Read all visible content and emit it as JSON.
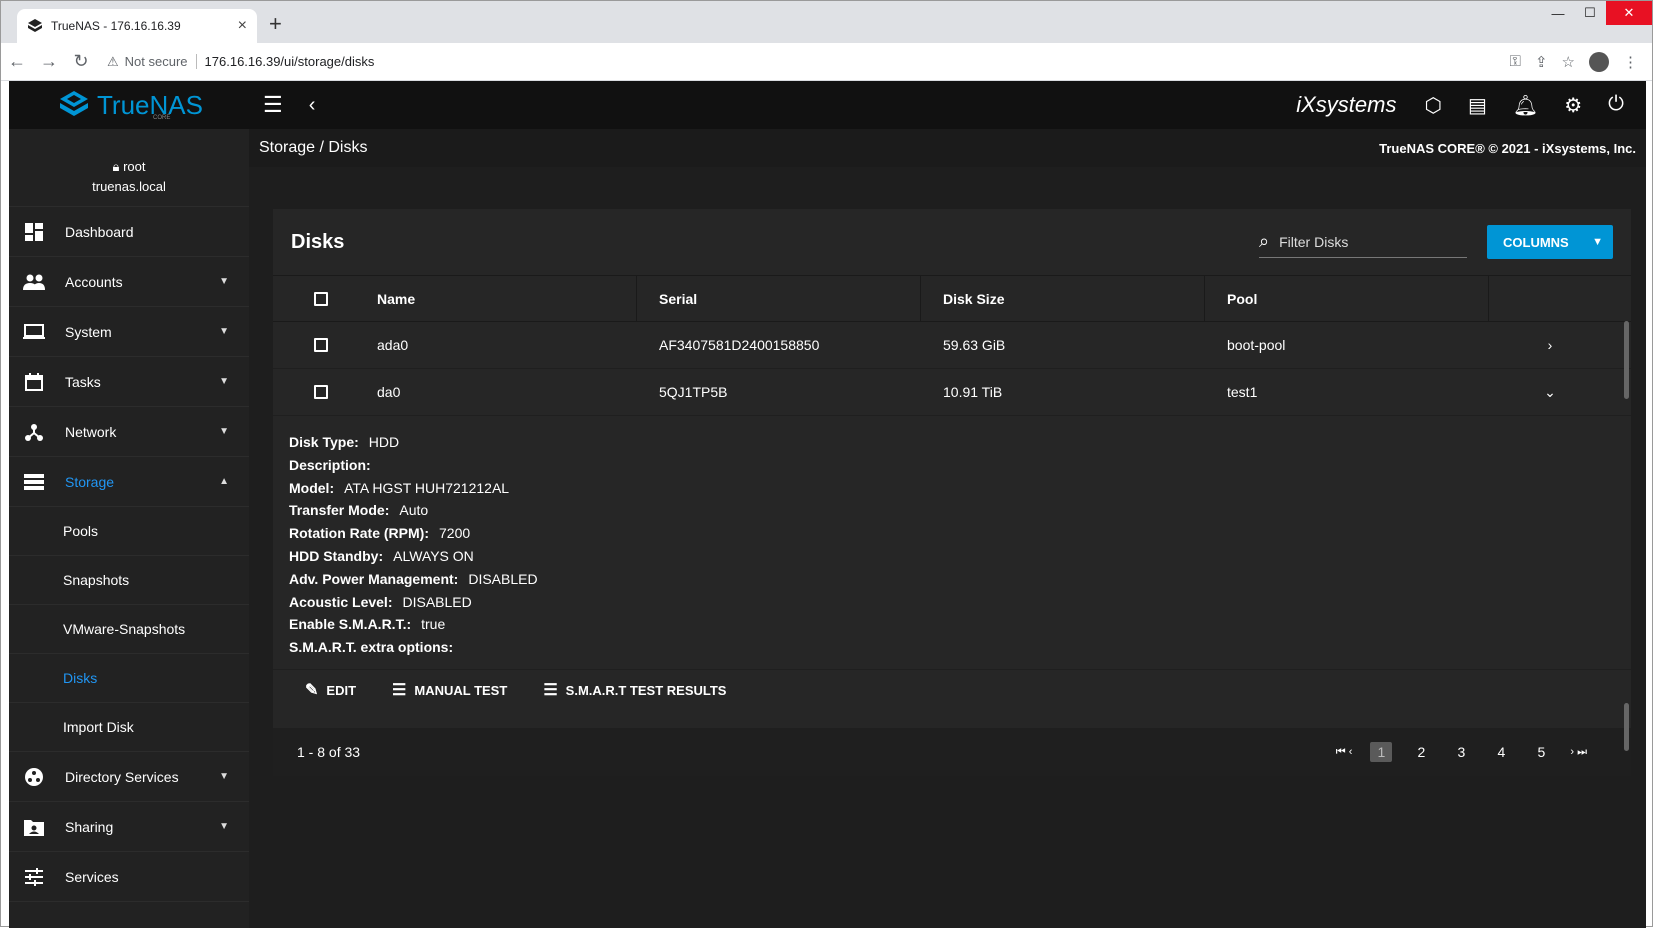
{
  "browser": {
    "tab_title": "TrueNAS - 176.16.16.39",
    "security": "Not secure",
    "url": "176.16.16.39/ui/storage/disks"
  },
  "app": {
    "brand": "TrueNAS",
    "brand_sub": "CORE",
    "vendor": "iXsystems",
    "breadcrumb": "Storage  /  Disks",
    "copyright": "TrueNAS CORE® © 2021 - iXsystems, Inc."
  },
  "user": {
    "name": "root",
    "host": "truenas.local"
  },
  "sidebar": {
    "items": [
      {
        "label": "Dashboard",
        "icon": "dashboard-icon"
      },
      {
        "label": "Accounts",
        "icon": "people-icon"
      },
      {
        "label": "System",
        "icon": "laptop-icon"
      },
      {
        "label": "Tasks",
        "icon": "calendar-icon"
      },
      {
        "label": "Network",
        "icon": "network-icon"
      },
      {
        "label": "Storage",
        "icon": "storage-icon"
      }
    ],
    "storage_sub": [
      "Pools",
      "Snapshots",
      "VMware-Snapshots",
      "Disks",
      "Import Disk"
    ],
    "items_after": [
      {
        "label": "Directory Services",
        "icon": "directory-icon"
      },
      {
        "label": "Sharing",
        "icon": "sharing-icon"
      },
      {
        "label": "Services",
        "icon": "tune-icon"
      }
    ]
  },
  "card": {
    "title": "Disks",
    "filter_placeholder": "Filter Disks",
    "columns_label": "COLUMNS",
    "headers": {
      "name": "Name",
      "serial": "Serial",
      "size": "Disk Size",
      "pool": "Pool"
    },
    "rows": [
      {
        "name": "ada0",
        "serial": "AF3407581D2400158850",
        "size": "59.63 GiB",
        "pool": "boot-pool"
      },
      {
        "name": "da0",
        "serial": "5QJ1TP5B",
        "size": "10.91 TiB",
        "pool": "test1"
      }
    ],
    "details": {
      "disk_type_k": "Disk Type:",
      "disk_type_v": "HDD",
      "description_k": "Description:",
      "description_v": "",
      "model_k": "Model:",
      "model_v": "ATA HGST HUH721212AL",
      "transfer_k": "Transfer Mode:",
      "transfer_v": "Auto",
      "rpm_k": "Rotation Rate (RPM):",
      "rpm_v": "7200",
      "standby_k": "HDD Standby:",
      "standby_v": "ALWAYS ON",
      "apm_k": "Adv. Power Management:",
      "apm_v": "DISABLED",
      "acoustic_k": "Acoustic Level:",
      "acoustic_v": "DISABLED",
      "smart_k": "Enable S.M.A.R.T.:",
      "smart_v": "true",
      "smart_opts_k": "S.M.A.R.T. extra options:",
      "smart_opts_v": ""
    },
    "actions": {
      "edit": "EDIT",
      "manual": "MANUAL TEST",
      "results": "S.M.A.R.T TEST RESULTS"
    },
    "range": "1 - 8 of 33",
    "pages": [
      "1",
      "2",
      "3",
      "4",
      "5"
    ]
  },
  "colors": {
    "accent": "#0095d5",
    "active": "#2196f3",
    "bg": "#1e1e1e"
  }
}
